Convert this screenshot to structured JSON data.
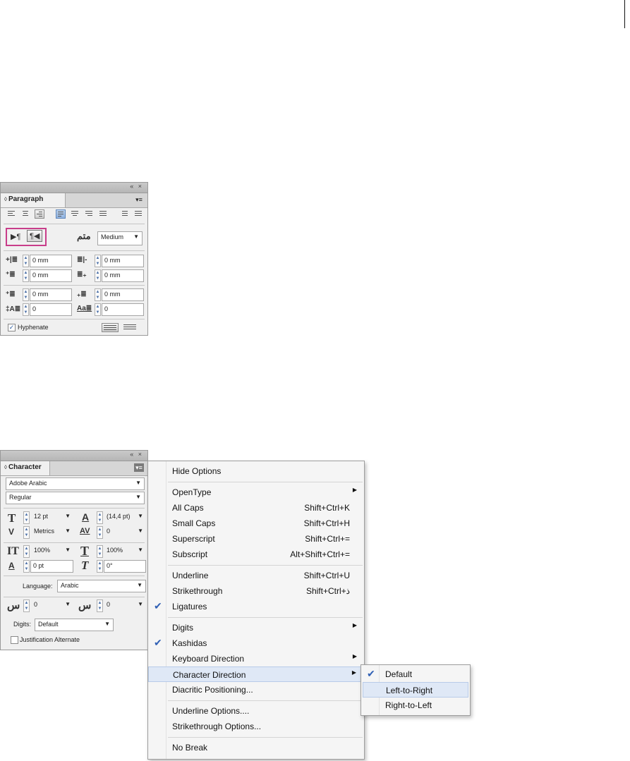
{
  "paragraph_panel": {
    "tab_title": "Paragraph",
    "topbar_buttons": "« ×",
    "menu_icon": "▾≡",
    "direction_ltr": "▶¶",
    "direction_rtl": "¶◀",
    "kashida_icon": "متم",
    "kashida_value": "Medium",
    "left_indent": "0 mm",
    "right_indent": "0 mm",
    "first_line_indent": "0 mm",
    "last_line_indent": "0 mm",
    "space_before": "0 mm",
    "space_after": "0 mm",
    "drop_cap_lines": "0",
    "drop_cap_chars": "0",
    "hyphenate_label": "Hyphenate",
    "hyphenate_checked": true
  },
  "character_panel": {
    "tab_title": "Character",
    "topbar_buttons": "« ×",
    "menu_icon": "▾≡",
    "font_family": "Adobe Arabic",
    "font_style": "Regular",
    "font_size": "12 pt",
    "leading": "(14,4 pt)",
    "kerning": "Metrics",
    "tracking": "0",
    "vertical_scale": "100%",
    "horizontal_scale": "100%",
    "baseline_shift": "0 pt",
    "skew": "0°",
    "language_label": "Language:",
    "language_value": "Arabic",
    "insert_space_left": "0",
    "insert_space_right": "0",
    "digits_label": "Digits:",
    "digits_value": "Default",
    "justification_label": "Justification Alternate",
    "justification_checked": false,
    "icon_font_size": "T",
    "icon_leading": "A",
    "icon_kerning": "V",
    "icon_tracking": "AV",
    "icon_vscale": "IT",
    "icon_hscale": "T",
    "icon_baseline": "A",
    "icon_skew": "T",
    "icon_space_l": "س",
    "icon_space_r": "س"
  },
  "context_menu": {
    "items": [
      {
        "label": "Hide Options",
        "shortcut": "",
        "checked": false,
        "submenu": false
      },
      {
        "label": "OpenType",
        "shortcut": "",
        "checked": false,
        "submenu": true
      },
      {
        "label": "All Caps",
        "shortcut": "Shift+Ctrl+K",
        "checked": false,
        "submenu": false
      },
      {
        "label": "Small Caps",
        "shortcut": "Shift+Ctrl+H",
        "checked": false,
        "submenu": false
      },
      {
        "label": "Superscript",
        "shortcut": "Shift+Ctrl+=",
        "checked": false,
        "submenu": false
      },
      {
        "label": "Subscript",
        "shortcut": "Alt+Shift+Ctrl+=",
        "checked": false,
        "submenu": false
      },
      {
        "label": "Underline",
        "shortcut": "Shift+Ctrl+U",
        "checked": false,
        "submenu": false
      },
      {
        "label": "Strikethrough",
        "shortcut": "Shift+Ctrl+ذ",
        "checked": false,
        "submenu": false
      },
      {
        "label": "Ligatures",
        "shortcut": "",
        "checked": true,
        "submenu": false
      },
      {
        "label": "Digits",
        "shortcut": "",
        "checked": false,
        "submenu": true
      },
      {
        "label": "Kashidas",
        "shortcut": "",
        "checked": true,
        "submenu": false
      },
      {
        "label": "Keyboard Direction",
        "shortcut": "",
        "checked": false,
        "submenu": true
      },
      {
        "label": "Character Direction",
        "shortcut": "",
        "checked": false,
        "submenu": true
      },
      {
        "label": "Diacritic Positioning...",
        "shortcut": "",
        "checked": false,
        "submenu": false
      },
      {
        "label": "Underline Options....",
        "shortcut": "",
        "checked": false,
        "submenu": false
      },
      {
        "label": "Strikethrough Options...",
        "shortcut": "",
        "checked": false,
        "submenu": false
      },
      {
        "label": "No Break",
        "shortcut": "",
        "checked": false,
        "submenu": false
      }
    ],
    "check_glyph": "✔",
    "submenu_glyph": "▶"
  },
  "submenu": {
    "items": [
      {
        "label": "Default",
        "checked": true
      },
      {
        "label": "Left-to-Right",
        "checked": false
      },
      {
        "label": "Right-to-Left",
        "checked": false
      }
    ]
  },
  "colors": {
    "highlight_box": "#c83d8a",
    "menu_hover": "#dfe8f6",
    "check": "#2f5fb4"
  }
}
